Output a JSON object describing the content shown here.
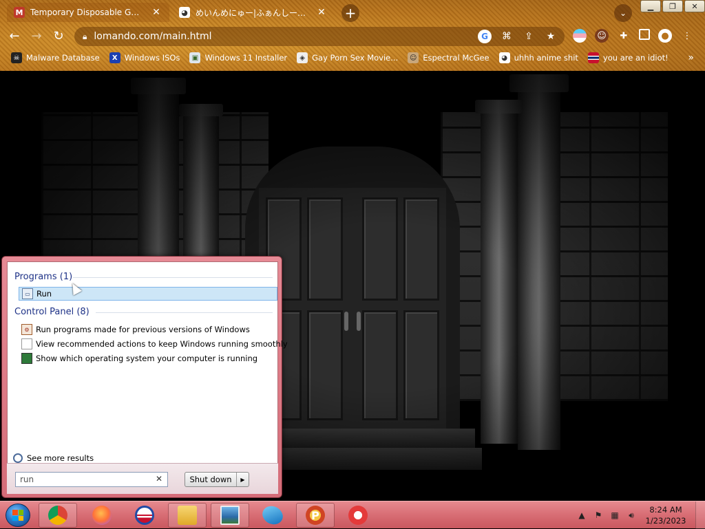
{
  "browser": {
    "tabs": [
      {
        "title": "Temporary Disposable Gmail | Te",
        "favicon": "gmail-icon",
        "active": true
      },
      {
        "title": "めいんめにゅー|ふぁんしーあいらんど",
        "favicon": "anime-icon",
        "active": false
      }
    ],
    "new_tab": "+",
    "address": {
      "url": "lomando.com/main.html"
    },
    "bookmarks": [
      {
        "label": "Malware Database",
        "icon": "skull-icon"
      },
      {
        "label": "Windows ISOs",
        "icon": "x-icon"
      },
      {
        "label": "Windows 11 Installer",
        "icon": "image-icon"
      },
      {
        "label": "Gay Porn Sex Movie...",
        "icon": "cube-icon"
      },
      {
        "label": "Espectral McGee",
        "icon": "face-icon"
      },
      {
        "label": "uhhh anime shit",
        "icon": "anime-icon"
      },
      {
        "label": "you are an idiot!",
        "icon": "flag-icon"
      }
    ],
    "bookmarks_more": "»"
  },
  "start_menu": {
    "programs_header": "Programs (1)",
    "programs": [
      {
        "label": "Run",
        "icon": "run-icon",
        "selected": true
      }
    ],
    "control_panel_header": "Control Panel (8)",
    "control_panel": [
      {
        "label": "Run programs made for previous versions of Windows",
        "icon": "compat-icon"
      },
      {
        "label": "View recommended actions to keep Windows running smoothly",
        "icon": "document-icon"
      },
      {
        "label": "Show which operating system your computer is running",
        "icon": "monitor-icon"
      }
    ],
    "see_more": "See more results",
    "search": {
      "value": "run",
      "clear": "✕"
    },
    "shutdown": {
      "label": "Shut down",
      "arrow": "▶"
    }
  },
  "taskbar": {
    "apps": [
      "chrome",
      "firefox",
      "obama",
      "explorer",
      "photos",
      "dolphin",
      "powerpoint",
      "ccleaner"
    ],
    "clock": {
      "time": "8:24 AM",
      "date": "1/23/2023"
    }
  },
  "colors": {
    "chrome_accent": "#c27a22",
    "taskbar": "#d86d74",
    "start_menu_frame": "#e07d88",
    "selection": "#cde6f7"
  }
}
